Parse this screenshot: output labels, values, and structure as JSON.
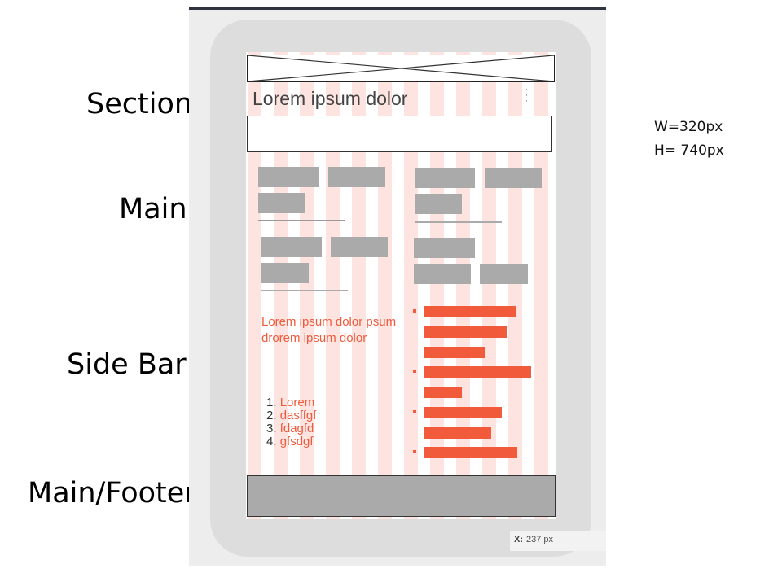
{
  "labels": {
    "section": "Section",
    "main": "Main",
    "sidebar": "Side Bar",
    "footer": "Main/Footer"
  },
  "dimensions": {
    "width": "W=320px",
    "height": "H= 740px"
  },
  "wireframe": {
    "title": "Lorem ipsum dolor",
    "paragraph": "Lorem ipsum dolor psum drorem ipsum dolor",
    "list": [
      {
        "num": "1.",
        "text": "Lorem"
      },
      {
        "num": "2.",
        "text": "dasffgf"
      },
      {
        "num": "3.",
        "text": "fdagfd"
      },
      {
        "num": "4.",
        "text": "gfsdgf"
      }
    ]
  },
  "readout": {
    "label": "X:",
    "value": "237 px"
  },
  "colors": {
    "accent": "#f15a3b",
    "placeholder_gray": "#aaaaaa",
    "grid_stripe": "#fde4e1",
    "device_frame": "#dddddd"
  }
}
